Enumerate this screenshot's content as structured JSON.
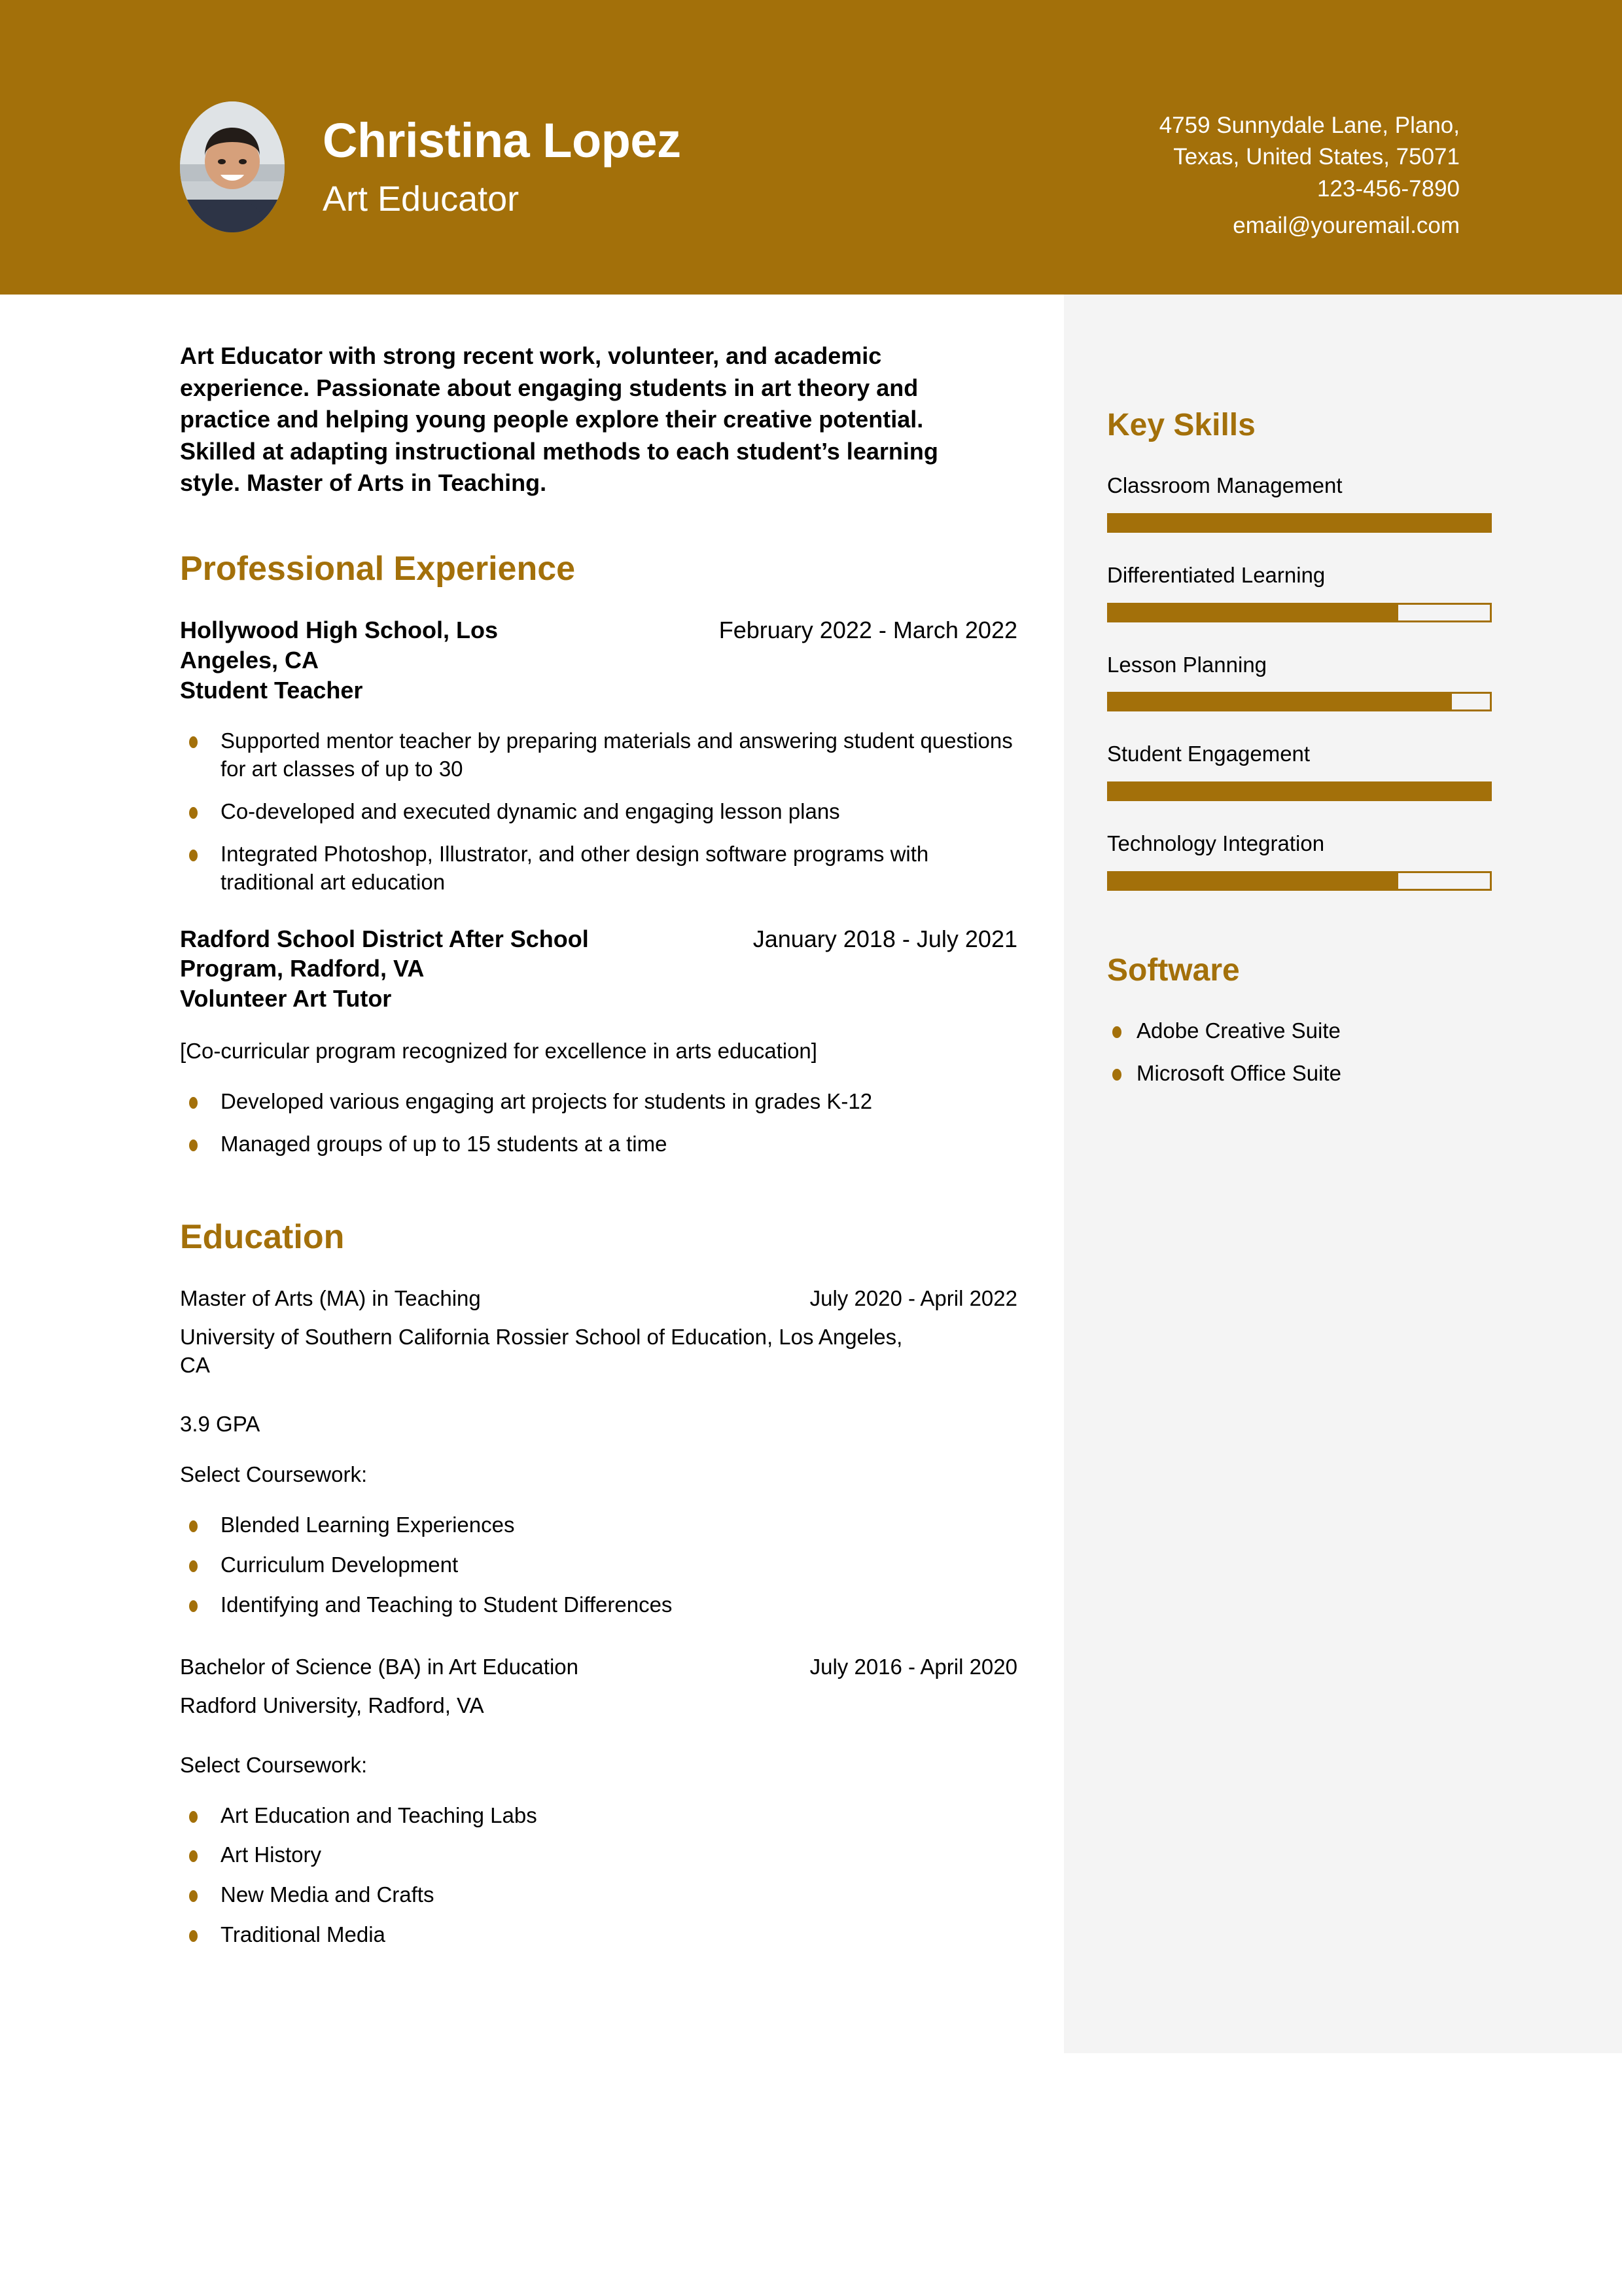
{
  "colors": {
    "accent": "#a3700a",
    "sidebar_bg": "#f4f4f4",
    "header_text": "#ffffff",
    "body_text": "#000000"
  },
  "header": {
    "name": "Christina Lopez",
    "role": "Art Educator",
    "contact": {
      "address_line1": "4759 Sunnydale Lane, Plano,",
      "address_line2": "Texas, United States, 75071",
      "phone": "123-456-7890",
      "email": "email@youremail.com"
    }
  },
  "summary": "Art Educator with strong recent work, volunteer, and academic experience. Passionate about engaging students in art theory and practice and helping young people explore their creative potential. Skilled at adapting instructional methods to each student’s learning style. Master of Arts in Teaching.",
  "experience": {
    "title": "Professional Experience",
    "jobs": [
      {
        "employer": "Hollywood High School, Los Angeles, CA",
        "dates": "February 2022 - March 2022",
        "position": "Student Teacher",
        "note": "",
        "bullets": [
          "Supported mentor teacher by preparing materials and answering student questions for art classes of up to 30",
          "Co-developed and executed dynamic and engaging lesson plans",
          "Integrated Photoshop, Illustrator, and other design software programs with traditional art education"
        ]
      },
      {
        "employer": "Radford School District After School Program, Radford, VA",
        "dates": "January 2018 - July 2021",
        "position": "Volunteer Art Tutor",
        "note": "[Co-curricular program recognized for excellence in arts education]",
        "bullets": [
          "Developed various engaging art projects for students in grades K-12",
          "Managed groups of up to 15 students at a time"
        ]
      }
    ]
  },
  "education": {
    "title": "Education",
    "entries": [
      {
        "degree": "Master of Arts (MA) in Teaching",
        "dates": "July 2020 - April 2022",
        "school": "University of Southern California Rossier School of Education, Los Angeles, CA",
        "gpa": "3.9 GPA",
        "coursework_label": "Select Coursework:",
        "coursework": [
          "Blended Learning Experiences",
          "Curriculum Development",
          "Identifying and Teaching to Student Differences"
        ]
      },
      {
        "degree": "Bachelor of Science (BA) in Art Education",
        "dates": "July 2016 - April 2020",
        "school": "Radford University, Radford, VA",
        "gpa": "",
        "coursework_label": "Select Coursework:",
        "coursework": [
          "Art Education and Teaching Labs",
          "Art History",
          "New Media and Crafts",
          "Traditional Media"
        ]
      }
    ]
  },
  "key_skills": {
    "title": "Key Skills",
    "items": [
      {
        "label": "Classroom Management",
        "level": 100
      },
      {
        "label": "Differentiated Learning",
        "level": 76
      },
      {
        "label": "Lesson Planning",
        "level": 90
      },
      {
        "label": "Student Engagement",
        "level": 100
      },
      {
        "label": "Technology Integration",
        "level": 76
      }
    ]
  },
  "software": {
    "title": "Software",
    "items": [
      "Adobe Creative Suite",
      "Microsoft Office Suite"
    ]
  }
}
